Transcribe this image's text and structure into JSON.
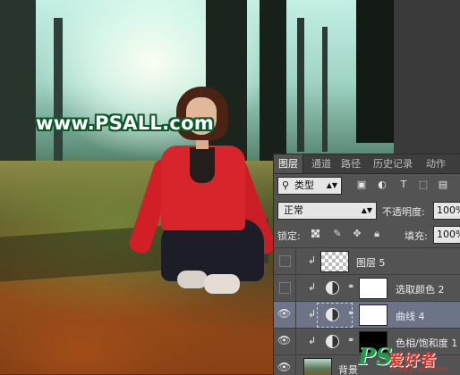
{
  "watermark": {
    "site": "www.PSALL.com"
  },
  "panel": {
    "tabs": [
      "图层",
      "通道",
      "路径",
      "历史记录",
      "动作"
    ],
    "active_tab": "图层",
    "filter": {
      "label": "类型",
      "icons": [
        "image-filter-icon",
        "adjustment-filter-icon",
        "type-filter-icon",
        "shape-filter-icon",
        "smart-object-filter-icon"
      ]
    },
    "blend_mode": "正常",
    "opacity_label": "不透明度:",
    "opacity_value": "100%",
    "lock_label": "锁定:",
    "fill_label": "填充:",
    "fill_value": "100%",
    "layers": [
      {
        "name": "图层 5",
        "visible": false,
        "selected": false
      },
      {
        "name": "选取颜色 2",
        "visible": false,
        "selected": false
      },
      {
        "name": "曲线 4",
        "visible": true,
        "selected": true
      },
      {
        "name": "色相/饱和度 1",
        "visible": true,
        "selected": false
      },
      {
        "name": "背景",
        "visible": true,
        "selected": false
      }
    ]
  },
  "logo": {
    "ps": "PS",
    "text": "爱好者",
    "url": "www.psahz.com"
  }
}
